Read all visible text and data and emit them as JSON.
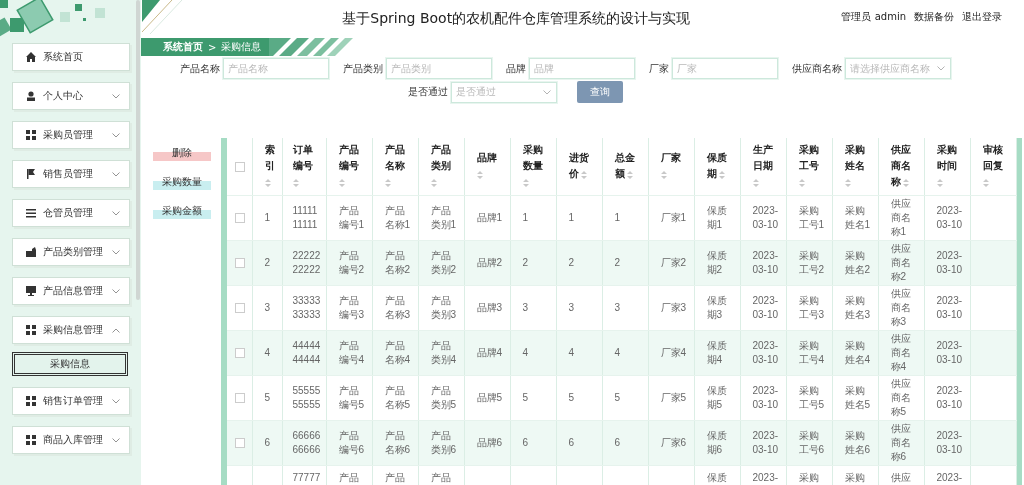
{
  "header": {
    "title": "基于Spring Boot的农机配件仓库管理系统的设计与实现",
    "links": [
      "管理员 admin",
      "数据备份",
      "退出登录"
    ]
  },
  "breadcrumb": {
    "items": [
      "系统首页",
      "采购信息"
    ],
    "separator": ">"
  },
  "sidebar": {
    "items": [
      {
        "label": "系统首页",
        "kind": "home"
      },
      {
        "label": "个人中心",
        "kind": "user",
        "expanded": false
      },
      {
        "label": "采购员管理",
        "kind": "grid",
        "expanded": false
      },
      {
        "label": "销售员管理",
        "kind": "flag",
        "expanded": false
      },
      {
        "label": "仓管员管理",
        "kind": "list",
        "expanded": false
      },
      {
        "label": "产品类别管理",
        "kind": "folder",
        "expanded": false
      },
      {
        "label": "产品信息管理",
        "kind": "monitor",
        "expanded": false
      },
      {
        "label": "采购信息管理",
        "kind": "grid",
        "expanded": true,
        "children": [
          {
            "label": "采购信息",
            "selected": true
          }
        ]
      },
      {
        "label": "销售订单管理",
        "kind": "grid",
        "expanded": false
      },
      {
        "label": "商品入库管理",
        "kind": "grid",
        "expanded": false
      }
    ]
  },
  "search": {
    "fields": [
      {
        "label": "产品名称",
        "placeholder": "产品名称",
        "kind": "input"
      },
      {
        "label": "产品类别",
        "placeholder": "产品类别",
        "kind": "input"
      },
      {
        "label": "品牌",
        "placeholder": "品牌",
        "kind": "input"
      },
      {
        "label": "厂家",
        "placeholder": "厂家",
        "kind": "input"
      },
      {
        "label": "供应商名称",
        "placeholder": "请选择供应商名称",
        "kind": "select"
      },
      {
        "label": "是否通过",
        "placeholder": "是否通过",
        "kind": "select"
      }
    ],
    "button": "查询"
  },
  "actions": [
    {
      "label": "删除",
      "kind": "danger"
    },
    {
      "label": "采购数量",
      "kind": "info"
    },
    {
      "label": "采购金额",
      "kind": "info"
    }
  ],
  "table": {
    "select_all": {
      "checked": false
    },
    "columns": [
      "索引",
      "订单编号",
      "产品编号",
      "产品名称",
      "产品类别",
      "品牌",
      "采购数量",
      "进货价",
      "总金额",
      "厂家",
      "保质期",
      "生产日期",
      "采购工号",
      "采购姓名",
      "供应商名称",
      "采购时间",
      "审核回复"
    ],
    "rows": [
      {
        "checked": false,
        "cells": [
          "1",
          "1111111111",
          "产品编号1",
          "产品名称1",
          "产品类别1",
          "品牌1",
          "1",
          "1",
          "1",
          "厂家1",
          "保质期1",
          "2023-03-10",
          "采购工号1",
          "采购姓名1",
          "供应商名称1",
          "2023-03-10",
          null
        ]
      },
      {
        "checked": false,
        "cells": [
          "2",
          "2222222222",
          "产品编号2",
          "产品名称2",
          "产品类别2",
          "品牌2",
          "2",
          "2",
          "2",
          "厂家2",
          "保质期2",
          "2023-03-10",
          "采购工号2",
          "采购姓名2",
          "供应商名称2",
          "2023-03-10",
          null
        ]
      },
      {
        "checked": false,
        "cells": [
          "3",
          "3333333333",
          "产品编号3",
          "产品名称3",
          "产品类别3",
          "品牌3",
          "3",
          "3",
          "3",
          "厂家3",
          "保质期3",
          "2023-03-10",
          "采购工号3",
          "采购姓名3",
          "供应商名称3",
          "2023-03-10",
          null
        ]
      },
      {
        "checked": false,
        "cells": [
          "4",
          "4444444444",
          "产品编号4",
          "产品名称4",
          "产品类别4",
          "品牌4",
          "4",
          "4",
          "4",
          "厂家4",
          "保质期4",
          "2023-03-10",
          "采购工号4",
          "采购姓名4",
          "供应商名称4",
          "2023-03-10",
          null
        ]
      },
      {
        "checked": false,
        "cells": [
          "5",
          "5555555555",
          "产品编号5",
          "产品名称5",
          "产品类别5",
          "品牌5",
          "5",
          "5",
          "5",
          "厂家5",
          "保质期5",
          "2023-03-10",
          "采购工号5",
          "采购姓名5",
          "供应商名称5",
          "2023-03-10",
          null
        ]
      },
      {
        "checked": false,
        "cells": [
          "6",
          "6666666666",
          "产品编号6",
          "产品名称6",
          "产品类别6",
          "品牌6",
          "6",
          "6",
          "6",
          "厂家6",
          "保质期6",
          "2023-03-10",
          "采购工号6",
          "采购姓名6",
          "供应商名称6",
          "2023-03-10",
          null
        ]
      },
      {
        "cells": [
          null,
          "77777",
          "产品",
          "产品",
          "产品",
          null,
          null,
          null,
          null,
          null,
          "保质",
          "2023-",
          "采购",
          "采购",
          "供应",
          "2023-",
          null
        ]
      }
    ]
  }
}
